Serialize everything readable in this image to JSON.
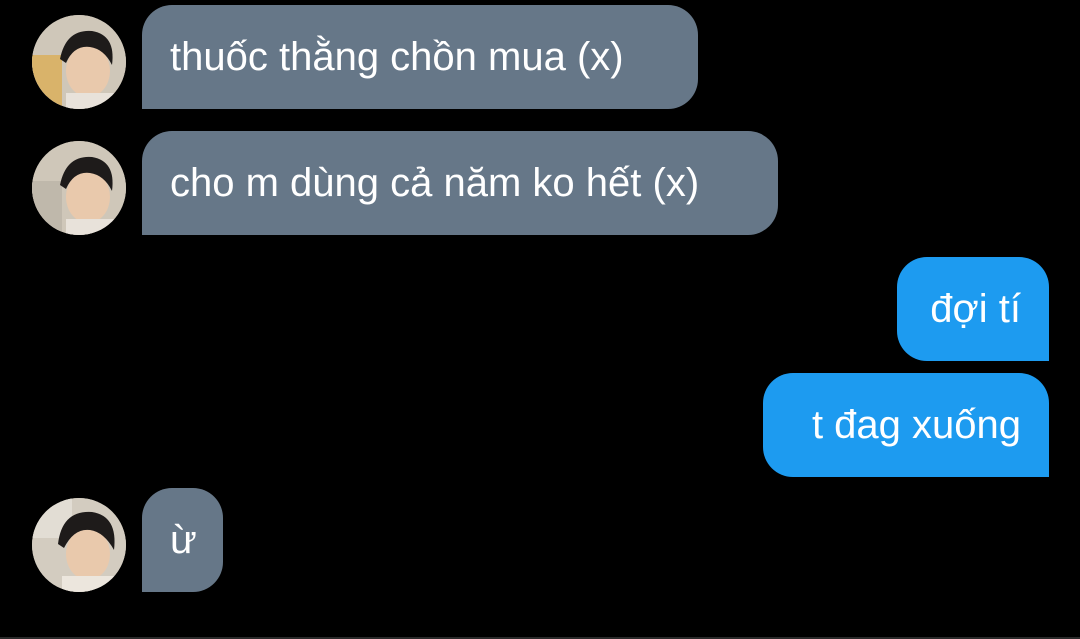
{
  "messages": [
    {
      "side": "received",
      "text": "thuốc thằng chồn mua (x)",
      "avatar": "contact-avatar"
    },
    {
      "side": "received",
      "text": "cho m dùng cả năm ko hết (x)",
      "avatar": "contact-avatar"
    },
    {
      "side": "sent",
      "text": "đợi tí"
    },
    {
      "side": "sent",
      "text": "t đag xuống"
    },
    {
      "side": "received",
      "text": "ừ",
      "avatar": "contact-avatar"
    }
  ],
  "colors": {
    "background": "#000000",
    "received_bubble": "#667788",
    "sent_bubble": "#1d9bf0",
    "text": "#ffffff"
  }
}
